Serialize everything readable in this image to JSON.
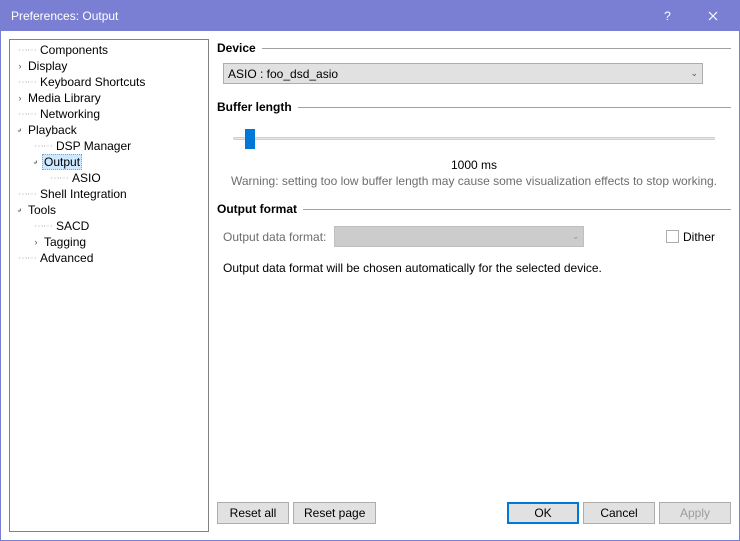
{
  "window": {
    "title": "Preferences: Output"
  },
  "sidebar": {
    "items": {
      "components": "Components",
      "display": "Display",
      "keyboard_shortcuts": "Keyboard Shortcuts",
      "media_library": "Media Library",
      "networking": "Networking",
      "playback": "Playback",
      "dsp_manager": "DSP Manager",
      "output": "Output",
      "asio": "ASIO",
      "shell_integration": "Shell Integration",
      "tools": "Tools",
      "sacd": "SACD",
      "tagging": "Tagging",
      "advanced": "Advanced"
    }
  },
  "main": {
    "device": {
      "title": "Device",
      "selected": "ASIO : foo_dsd_asio"
    },
    "buffer": {
      "title": "Buffer length",
      "value": "1000 ms",
      "warning": "Warning: setting too low buffer length may cause some visualization effects to stop working."
    },
    "output_format": {
      "title": "Output format",
      "label": "Output data format:",
      "dither": "Dither",
      "note": "Output data format will be chosen automatically for the selected device."
    }
  },
  "footer": {
    "reset_all": "Reset all",
    "reset_page": "Reset page",
    "ok": "OK",
    "cancel": "Cancel",
    "apply": "Apply"
  }
}
